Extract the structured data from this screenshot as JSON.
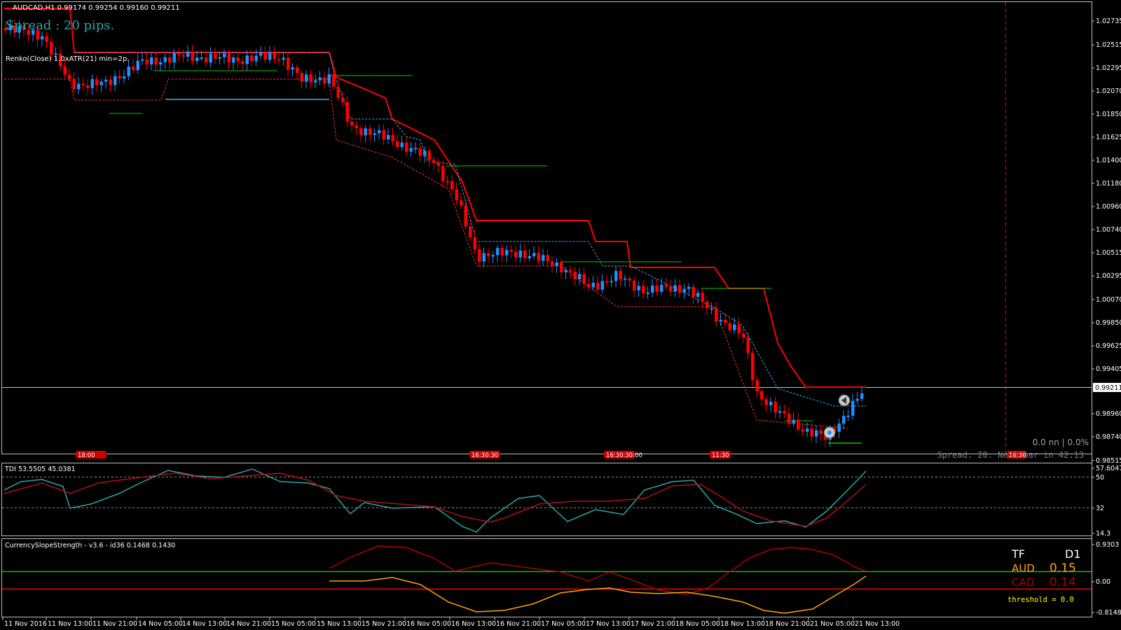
{
  "header": {
    "symbol_line": "AUDCAD,H1  0.99174 0.99254 0.99160 0.99211",
    "spread_label": "Spread : 20 pips.",
    "renko_label": "Renko(Close) 1.0xATR(21) min=2p."
  },
  "main_axis": {
    "labels": [
      "1.02735",
      "1.02515",
      "1.02295",
      "1.02070",
      "1.01850",
      "1.01625",
      "1.01400",
      "1.01180",
      "1.00960",
      "1.00740",
      "1.00515",
      "1.00295",
      "1.00070",
      "0.99850",
      "0.99625",
      "0.99405",
      "0.98960",
      "0.98740",
      "0.98515"
    ],
    "current_price": "0.99211"
  },
  "session_tags": [
    "18:00",
    "16:30:30",
    "16:30:30:00",
    "11:30",
    "16:30"
  ],
  "main_bottom": {
    "status": "0.0 nn | 0.0%",
    "spread_info": "Spread: 20. Next bar in 42:13"
  },
  "tdi": {
    "title": "TDI 53.5505 45.0381",
    "axis": [
      "57.6047",
      "50",
      "32",
      "14.3"
    ]
  },
  "css": {
    "title": "CurrencySlopeStrength - v3.6 - id36 0.1468 0.1430",
    "axis": [
      "0.9303",
      "0.00",
      "-0.8148"
    ],
    "tf_label": "TF",
    "tf_value": "D1",
    "rows": [
      {
        "name": "AUD",
        "value": "0.15",
        "color": "#ffa500"
      },
      {
        "name": "CAD",
        "value": "0.14",
        "color": "#b00000"
      }
    ],
    "threshold": "threshold = 0.0"
  },
  "time_axis": [
    "11 Nov 2016",
    "11 Nov 13:00",
    "11 Nov 21:00",
    "14 Nov 05:00",
    "14 Nov 13:00",
    "14 Nov 21:00",
    "15 Nov 05:00",
    "15 Nov 13:00",
    "15 Nov 21:00",
    "16 Nov 05:00",
    "16 Nov 13:00",
    "16 Nov 21:00",
    "17 Nov 05:00",
    "17 Nov 13:00",
    "17 Nov 21:00",
    "18 Nov 05:00",
    "18 Nov 13:00",
    "18 Nov 21:00",
    "21 Nov 05:00",
    "21 Nov 13:00"
  ],
  "colors": {
    "bull": "#1e90ff",
    "bear": "#ff0000",
    "teal": "#2aa6a6",
    "grid": "#c0c0c0",
    "green": "#00cc00"
  }
}
